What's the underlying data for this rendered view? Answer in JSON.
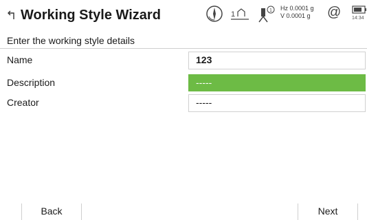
{
  "header": {
    "title": "Working Style Wizard",
    "tilt": {
      "hz": "Hz 0.0001 g",
      "v": "V  0.0001 g"
    },
    "prism_label": "1",
    "at_symbol": "@",
    "clock": "14:34",
    "icons": [
      "back-arrow-icon",
      "compass-icon",
      "prism-icon",
      "tilt-sensor-icon",
      "at-icon",
      "battery-icon"
    ]
  },
  "instruction": "Enter the working style details",
  "fields": [
    {
      "label": "Name",
      "value": "123"
    },
    {
      "label": "Description",
      "value": "-----"
    },
    {
      "label": "Creator",
      "value": "-----"
    }
  ],
  "footer": {
    "back_label": "Back",
    "next_label": "Next"
  },
  "colors": {
    "selection": "#6dbb45",
    "border": "#d0d0d0",
    "text": "#1a1a1a"
  }
}
